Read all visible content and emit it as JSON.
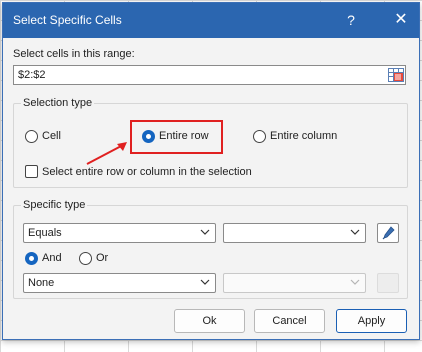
{
  "dialog": {
    "title": "Select Specific Cells",
    "help_label": "?",
    "close_label": "✕"
  },
  "range": {
    "label": "Select cells in this range:",
    "value": "$2:$2"
  },
  "selection_type": {
    "title": "Selection type",
    "options": [
      "Cell",
      "Entire row",
      "Entire column"
    ],
    "selected": "Entire row",
    "checkbox_label": "Select entire row or column in the selection",
    "checkbox_checked": false
  },
  "specific_type": {
    "title": "Specific type",
    "condition1": "Equals",
    "value1": "",
    "logic_options": [
      "And",
      "Or"
    ],
    "logic_selected": "And",
    "condition2": "None",
    "value2": ""
  },
  "buttons": {
    "ok": "Ok",
    "cancel": "Cancel",
    "apply": "Apply"
  },
  "colors": {
    "accent": "#2b66b0",
    "highlight": "#e02020"
  }
}
